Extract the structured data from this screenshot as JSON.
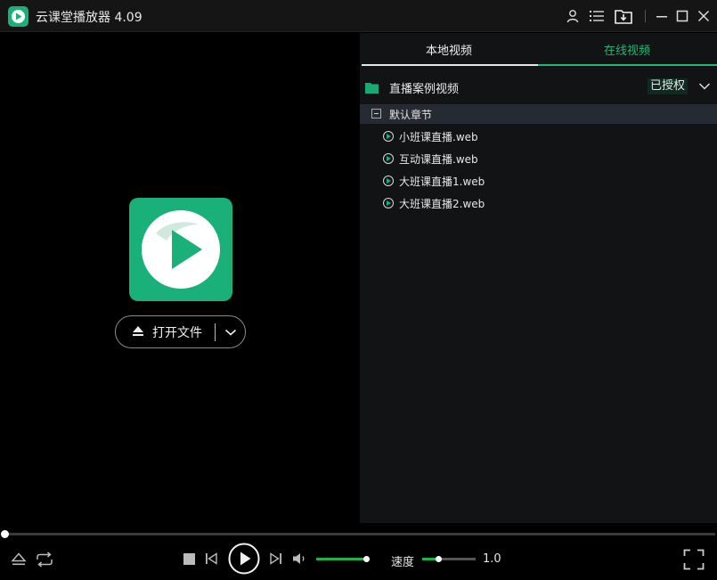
{
  "app": {
    "title": "云课堂播放器 4.09",
    "brand_color": "#19b07a"
  },
  "titlebar": {
    "icons": [
      "user-icon",
      "list-icon",
      "download-folder-icon",
      "minimize-icon",
      "maximize-icon",
      "close-icon"
    ]
  },
  "player": {
    "open_file_label": "打开文件"
  },
  "panel": {
    "tabs": [
      {
        "label": "本地视频",
        "active": false
      },
      {
        "label": "在线视频",
        "active": true
      }
    ],
    "accent_color": "#22b57a",
    "folder": {
      "name": "直播案例视频",
      "badge": "已授权"
    },
    "chapter": {
      "label": "默认章节"
    },
    "files": [
      {
        "name": "小班课直播.web"
      },
      {
        "name": "互动课直播.web"
      },
      {
        "name": "大班课直播1.web"
      },
      {
        "name": "大班课直播2.web"
      }
    ]
  },
  "controls": {
    "progress_fraction": 0.0,
    "volume_fraction": 0.95,
    "speed_label": "速度",
    "speed_value": "1.0",
    "speed_fraction": 0.3
  }
}
